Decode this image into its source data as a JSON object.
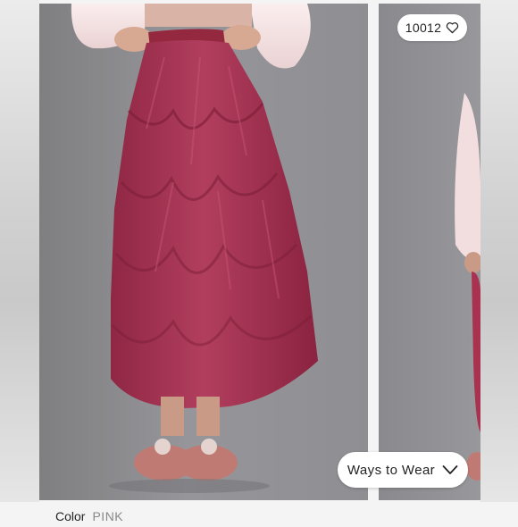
{
  "gallery": {
    "main_image": "model wearing ruffled tulle midi skirt",
    "next_image": "partial view of next product photo"
  },
  "likes_badge": {
    "count": "10012",
    "icon": "heart-icon"
  },
  "ways_to_wear": {
    "label": "Ways to Wear",
    "icon": "chevron-down-icon"
  },
  "product": {
    "color_label": "Color",
    "color_value": "PINK"
  },
  "colors": {
    "skirt": "#a23452",
    "backdrop": "#8e8e92",
    "sweater": "#f1dcdc"
  }
}
